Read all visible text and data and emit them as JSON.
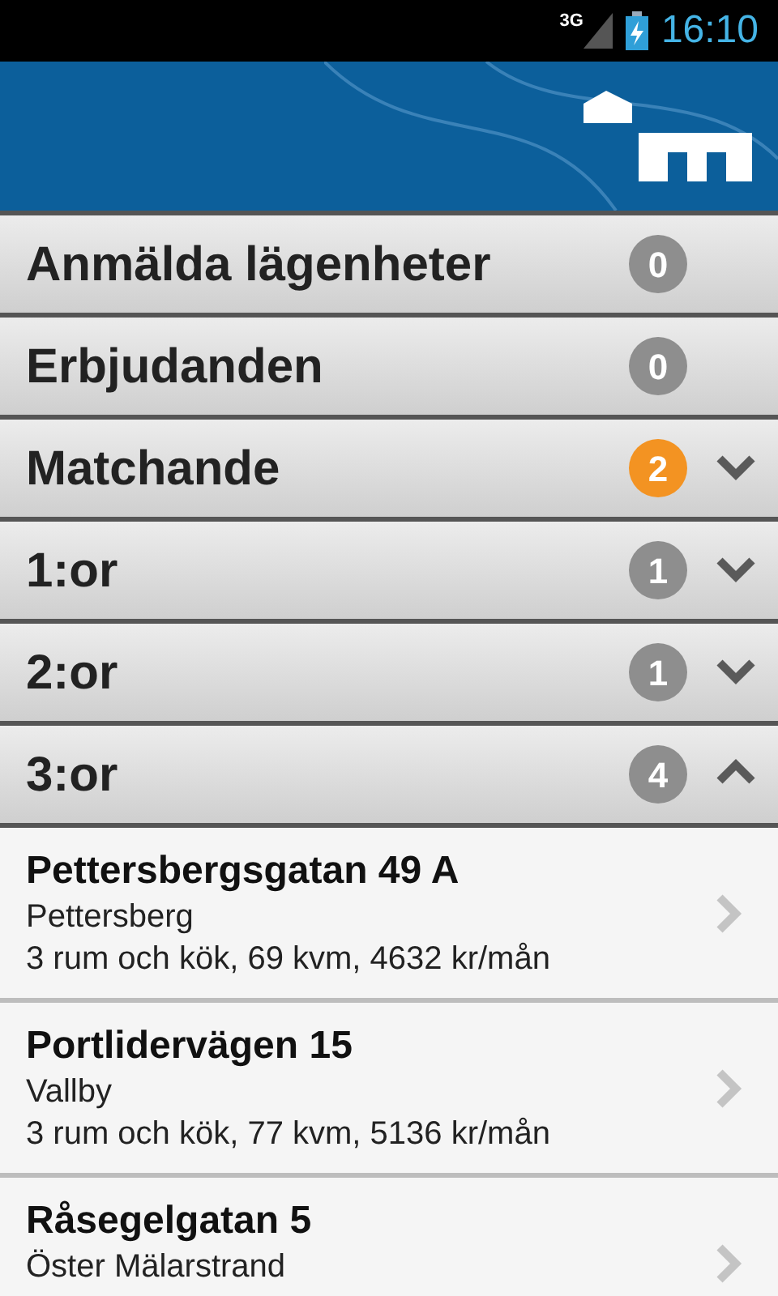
{
  "status_bar": {
    "network": "3G",
    "time": "16:10"
  },
  "categories": [
    {
      "label": "Anmälda lägenheter",
      "count": "0",
      "color": "#8e8e8e",
      "kind": "plain"
    },
    {
      "label": "Erbjudanden",
      "count": "0",
      "color": "#8e8e8e",
      "kind": "plain"
    },
    {
      "label": "Matchande",
      "count": "2",
      "color": "#f39322",
      "kind": "expandable",
      "expanded": false
    },
    {
      "label": "1:or",
      "count": "1",
      "color": "#8e8e8e",
      "kind": "expandable",
      "expanded": false
    },
    {
      "label": "2:or",
      "count": "1",
      "color": "#8e8e8e",
      "kind": "expandable",
      "expanded": false
    },
    {
      "label": "3:or",
      "count": "4",
      "color": "#8e8e8e",
      "kind": "expandable",
      "expanded": true
    }
  ],
  "listings": [
    {
      "address": "Pettersbergsgatan 49 A",
      "area": "Pettersberg",
      "details": "3 rum och kök, 69 kvm, 4632 kr/mån"
    },
    {
      "address": "Portlidervägen 15",
      "area": "Vallby",
      "details": "3 rum och kök, 77 kvm, 5136 kr/mån"
    },
    {
      "address": "Råsegelgatan 5",
      "area": "Öster Mälarstrand"
    }
  ]
}
